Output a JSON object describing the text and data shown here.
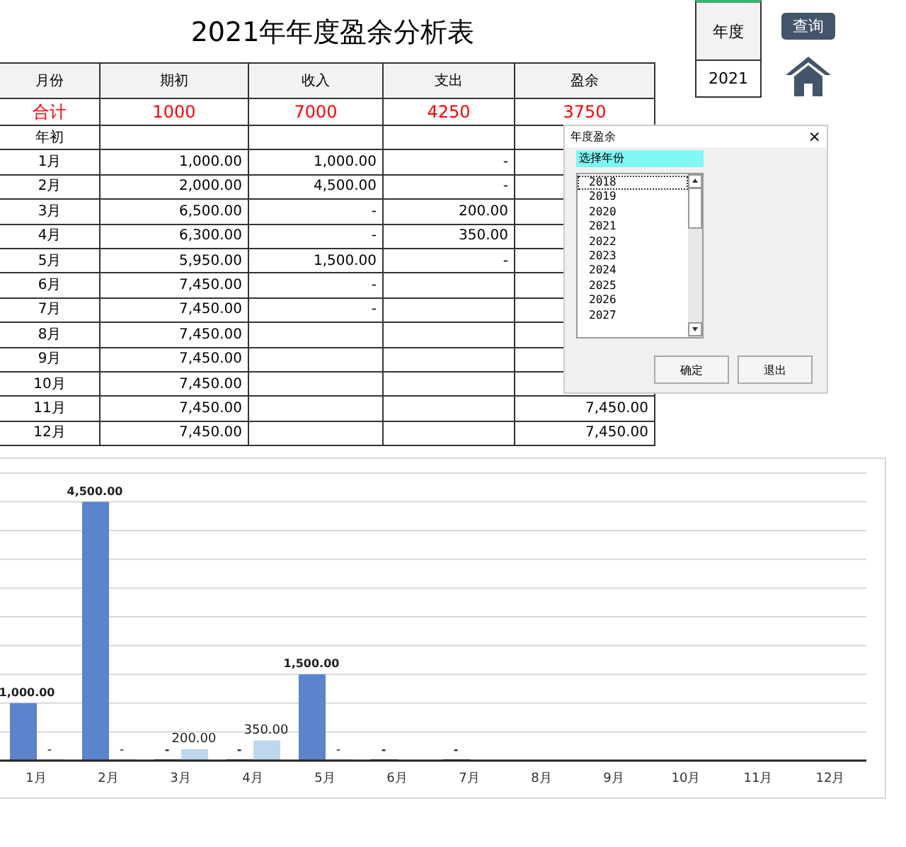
{
  "title": "2021年年度盈余分析表",
  "year_box": {
    "label": "年度",
    "value": "2021"
  },
  "query_button": "查询",
  "table": {
    "columns": [
      "月份",
      "期初",
      "收入",
      "支出",
      "盈余"
    ],
    "total": {
      "label": "合计",
      "opening": "1000",
      "income": "7000",
      "expense": "4250",
      "surplus": "3750"
    },
    "rows": [
      {
        "month": "年初"
      },
      {
        "month": "1月",
        "opening": "1,000.00",
        "income": "1,000.00",
        "expense": "-"
      },
      {
        "month": "2月",
        "opening": "2,000.00",
        "income": "4,500.00",
        "expense": "-"
      },
      {
        "month": "3月",
        "opening": "6,500.00",
        "income": "-",
        "expense": "200.00"
      },
      {
        "month": "4月",
        "opening": "6,300.00",
        "income": "-",
        "expense": "350.00"
      },
      {
        "month": "5月",
        "opening": "5,950.00",
        "income": "1,500.00",
        "expense": "-"
      },
      {
        "month": "6月",
        "opening": "7,450.00",
        "income": "-"
      },
      {
        "month": "7月",
        "opening": "7,450.00",
        "income": "-"
      },
      {
        "month": "8月",
        "opening": "7,450.00"
      },
      {
        "month": "9月",
        "opening": "7,450.00"
      },
      {
        "month": "10月",
        "opening": "7,450.00"
      },
      {
        "month": "11月",
        "opening": "7,450.00",
        "surplus": "7,450.00"
      },
      {
        "month": "12月",
        "opening": "7,450.00",
        "surplus": "7,450.00"
      }
    ]
  },
  "chart": {
    "chart_data": {
      "type": "bar",
      "categories": [
        "1月",
        "2月",
        "3月",
        "4月",
        "5月",
        "6月",
        "7月",
        "8月",
        "9月",
        "10月",
        "11月",
        "12月"
      ],
      "ylim": [
        0,
        5000
      ],
      "data_labels": true,
      "series": [
        {
          "color": "#5b84cc",
          "values": [
            1000,
            4500,
            0,
            0,
            1500,
            0,
            0,
            null,
            null,
            null,
            null,
            null
          ],
          "value_labels": [
            "1,000.00",
            "4,500.00",
            "-",
            "-",
            "1,500.00",
            "-",
            "-",
            null,
            null,
            null,
            null,
            null
          ]
        },
        {
          "color": "#bdd7ee",
          "values": [
            0,
            0,
            200,
            350,
            0,
            null,
            null,
            null,
            null,
            null,
            null,
            null
          ],
          "value_labels": [
            "-",
            "-",
            "200.00",
            "350.00",
            "-",
            null,
            null,
            null,
            null,
            null,
            null,
            null
          ]
        }
      ]
    }
  },
  "dialog": {
    "title": "年度盈余",
    "close": "×",
    "field": "选择年份",
    "years": [
      {
        "label": "2018",
        "focused": true
      },
      {
        "label": "2019",
        "focused": false
      },
      {
        "label": "2020",
        "focused": false
      },
      {
        "label": "2021",
        "focused": false
      },
      {
        "label": "2022",
        "focused": false
      },
      {
        "label": "2023",
        "focused": false
      },
      {
        "label": "2024",
        "focused": false
      },
      {
        "label": "2025",
        "focused": false
      },
      {
        "label": "2026",
        "focused": false
      },
      {
        "label": "2027",
        "focused": false
      }
    ],
    "buttons": [
      "确定",
      "退出"
    ]
  }
}
